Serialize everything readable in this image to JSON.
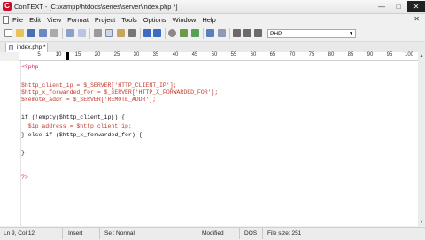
{
  "window": {
    "app_icon": "C",
    "title": "ConTEXT - [C:\\xampp\\htdocs\\series\\server\\index.php *]",
    "minimize_icon": "minimize-icon",
    "maximize_icon": "maximize-icon",
    "close_icon": "close-icon",
    "minimize_glyph": "—",
    "maximize_glyph": "□",
    "close_glyph": "✕"
  },
  "menu": {
    "items": [
      "File",
      "Edit",
      "View",
      "Format",
      "Project",
      "Tools",
      "Options",
      "Window",
      "Help"
    ],
    "close_glyph": "✕"
  },
  "toolbar": {
    "language_value": "PHP",
    "dropdown_glyph": "▼"
  },
  "tab": {
    "label": "index.php *"
  },
  "ruler": {
    "labels": [
      "5",
      "10",
      "15",
      "20",
      "25",
      "30",
      "35",
      "40",
      "45",
      "50",
      "55",
      "60",
      "65",
      "70",
      "75",
      "80",
      "85",
      "90",
      "95",
      "100"
    ]
  },
  "code": {
    "line1": "<?php",
    "line3": "$http_client_ip = $_SERVER['HTTP_CLIENT_IP'];",
    "line4": "$http_x_forwarded_for = $_SERVER['HTTP_X_FORWARDED_FOR'];",
    "line5": "$remote_addr = $_SERVER['REMOTE_ADDR'];",
    "line7": "if (!empty($http_client_ip)) {",
    "line8": "  $ip_address = $http_client_ip;",
    "line9": "} else if ($http_x_forwarded_for) {",
    "line10": "",
    "line11": "}",
    "line14": "?>"
  },
  "status": {
    "position": "Ln 9, Col 12",
    "mode": "Insert",
    "selection": "Sel: Normal",
    "modified": "Modified",
    "line_ending": "DOS",
    "file_size": "File size: 251"
  }
}
